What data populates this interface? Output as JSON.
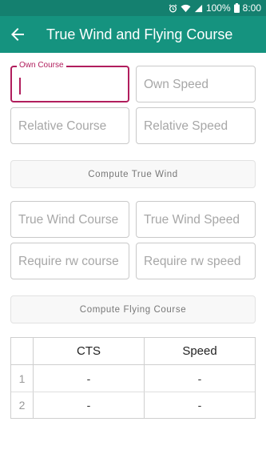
{
  "status_bar": {
    "battery": "100%",
    "time": "8:00"
  },
  "app_bar": {
    "title": "True Wind and Flying Course"
  },
  "fields": {
    "own_course": {
      "label": "Own Course",
      "value": ""
    },
    "own_speed": {
      "placeholder": "Own Speed"
    },
    "relative_course": {
      "placeholder": "Relative Course"
    },
    "relative_speed": {
      "placeholder": "Relative Speed"
    },
    "true_wind_course": {
      "placeholder": "True Wind Course"
    },
    "true_wind_speed": {
      "placeholder": "True Wind Speed"
    },
    "require_rw_course": {
      "placeholder": "Require rw course"
    },
    "require_rw_speed": {
      "placeholder": "Require rw speed"
    }
  },
  "buttons": {
    "compute_true_wind": "Compute True Wind",
    "compute_flying_course": "Compute Flying Course"
  },
  "table": {
    "headers": [
      "CTS",
      "Speed"
    ],
    "rows": [
      {
        "num": "1",
        "cts": "-",
        "speed": "-"
      },
      {
        "num": "2",
        "cts": "-",
        "speed": "-"
      }
    ]
  },
  "colors": {
    "status_bar": "#14806f",
    "app_bar": "#15937f",
    "accent": "#b11e5d"
  }
}
